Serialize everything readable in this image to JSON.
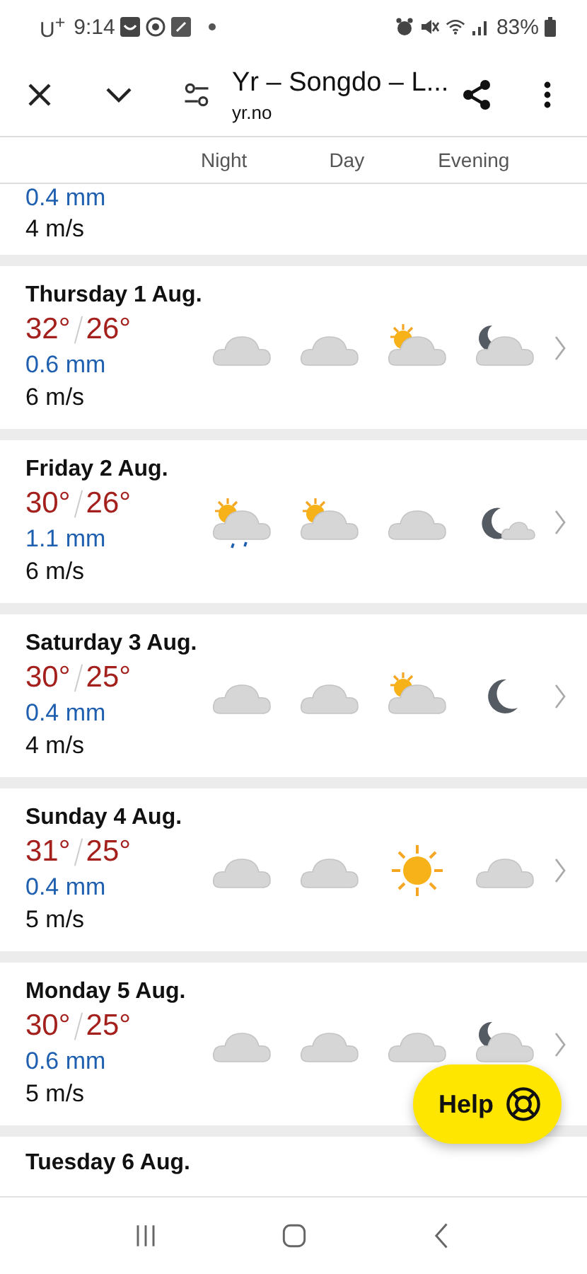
{
  "status_bar": {
    "carrier": "U$^{+}$",
    "time": "9:14",
    "battery": "83%"
  },
  "toolbar": {
    "title": "Yr – Songdo – L...",
    "subtitle": "yr.no"
  },
  "columns": [
    "Night",
    "Day",
    "Evening"
  ],
  "partial_day": {
    "precipitation": "0.4 mm",
    "wind": "4 m/s"
  },
  "days": [
    {
      "date": "Thursday 1 Aug.",
      "high": "32°",
      "low": "26°",
      "precipitation": "0.6 mm",
      "wind": "6 m/s",
      "icons": [
        {
          "kind": "cloud"
        },
        {
          "kind": "cloud"
        },
        {
          "kind": "sun-cloud"
        },
        {
          "kind": "moon-cloud"
        }
      ]
    },
    {
      "date": "Friday 2 Aug.",
      "high": "30°",
      "low": "26°",
      "precipitation": "1.1 mm",
      "wind": "6 m/s",
      "icons": [
        {
          "kind": "rain-sun-cloud"
        },
        {
          "kind": "sun-cloud"
        },
        {
          "kind": "cloud"
        },
        {
          "kind": "moon-small-cloud"
        }
      ]
    },
    {
      "date": "Saturday 3 Aug.",
      "high": "30°",
      "low": "25°",
      "precipitation": "0.4 mm",
      "wind": "4 m/s",
      "icons": [
        {
          "kind": "cloud"
        },
        {
          "kind": "cloud"
        },
        {
          "kind": "sun-cloud"
        },
        {
          "kind": "moon"
        }
      ]
    },
    {
      "date": "Sunday 4 Aug.",
      "high": "31°",
      "low": "25°",
      "precipitation": "0.4 mm",
      "wind": "5 m/s",
      "icons": [
        {
          "kind": "cloud"
        },
        {
          "kind": "cloud"
        },
        {
          "kind": "sun"
        },
        {
          "kind": "cloud"
        }
      ]
    },
    {
      "date": "Monday 5 Aug.",
      "high": "30°",
      "low": "25°",
      "precipitation": "0.6 mm",
      "wind": "5 m/s",
      "icons": [
        {
          "kind": "cloud"
        },
        {
          "kind": "cloud"
        },
        {
          "kind": "cloud"
        },
        {
          "kind": "moon-cloud"
        }
      ]
    }
  ],
  "partial_next_day": {
    "date": "Tuesday 6 Aug."
  },
  "help_button": {
    "label": "Help"
  }
}
